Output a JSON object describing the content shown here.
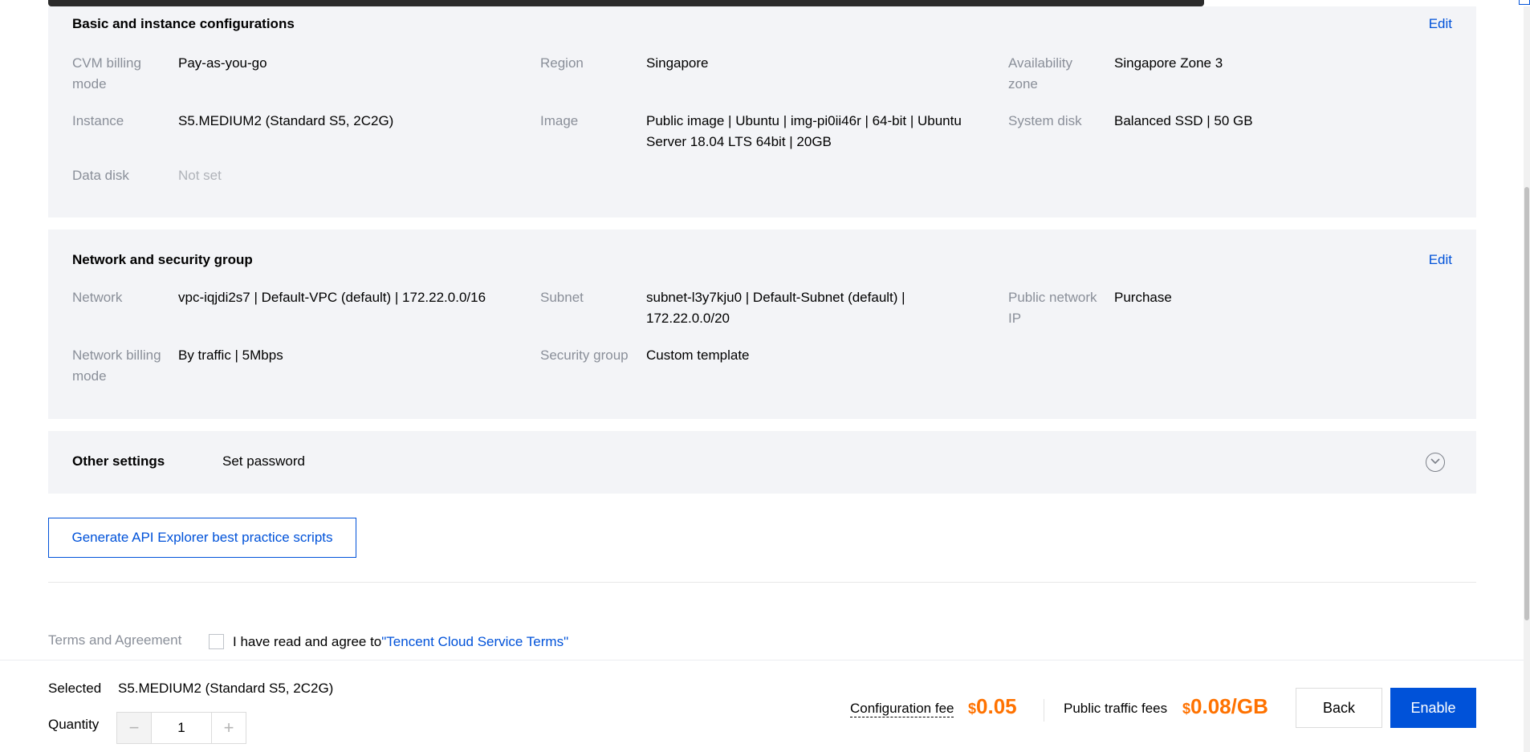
{
  "basic": {
    "title": "Basic and instance configurations",
    "edit": "Edit",
    "fields": [
      {
        "label_1": "CVM billing",
        "label_2": "mode",
        "value": "Pay-as-you-go"
      },
      {
        "label": "Region",
        "value": "Singapore"
      },
      {
        "label_1": "Availability",
        "label_2": "zone",
        "value": "Singapore Zone 3"
      },
      {
        "label": "Instance",
        "value": "S5.MEDIUM2 (Standard S5, 2C2G)"
      },
      {
        "label": "Image",
        "value_1": "Public image | Ubuntu | img-pi0ii46r | 64-bit | Ubuntu",
        "value_2": "Server 18.04 LTS 64bit | 20GB"
      },
      {
        "label": "System disk",
        "value": "Balanced SSD | 50 GB"
      },
      {
        "label": "Data disk",
        "value": "Not set"
      }
    ]
  },
  "network": {
    "title": "Network and security group",
    "edit": "Edit",
    "fields": [
      {
        "label": "Network",
        "value": "vpc-iqjdi2s7 | Default-VPC (default) | 172.22.0.0/16"
      },
      {
        "label": "Subnet",
        "value_1": "subnet-l3y7kju0 | Default-Subnet (default) |",
        "value_2": "172.22.0.0/20"
      },
      {
        "label_1": "Public network",
        "label_2": "IP",
        "value": "Purchase"
      },
      {
        "label_1": "Network billing",
        "label_2": "mode",
        "value": "By traffic | 5Mbps"
      },
      {
        "label": "Security group",
        "value": "Custom template"
      }
    ]
  },
  "other": {
    "title": "Other settings",
    "value": "Set password"
  },
  "api_button": "Generate API Explorer best practice scripts",
  "terms": {
    "label": "Terms and Agreement",
    "text": "I have read and agree to",
    "link": "\"Tencent Cloud Service Terms\""
  },
  "footer": {
    "selected_label": "Selected",
    "selected_value": "S5.MEDIUM2 (Standard S5, 2C2G)",
    "quantity_label": "Quantity",
    "quantity": "1",
    "minus": "−",
    "plus": "+",
    "config_fee_label": "Configuration fee",
    "config_fee_currency": "$",
    "config_fee_value": "0.05",
    "traffic_fee_label": "Public traffic fees",
    "traffic_fee_currency": "$",
    "traffic_fee_value": "0.08/GB",
    "back": "Back",
    "enable": "Enable"
  },
  "colors": {
    "accent": "#0052d9",
    "price": "#ff7200",
    "panel_bg": "#f3f4f7"
  },
  "icons": {
    "expand": "chevron-down-circle-icon"
  }
}
